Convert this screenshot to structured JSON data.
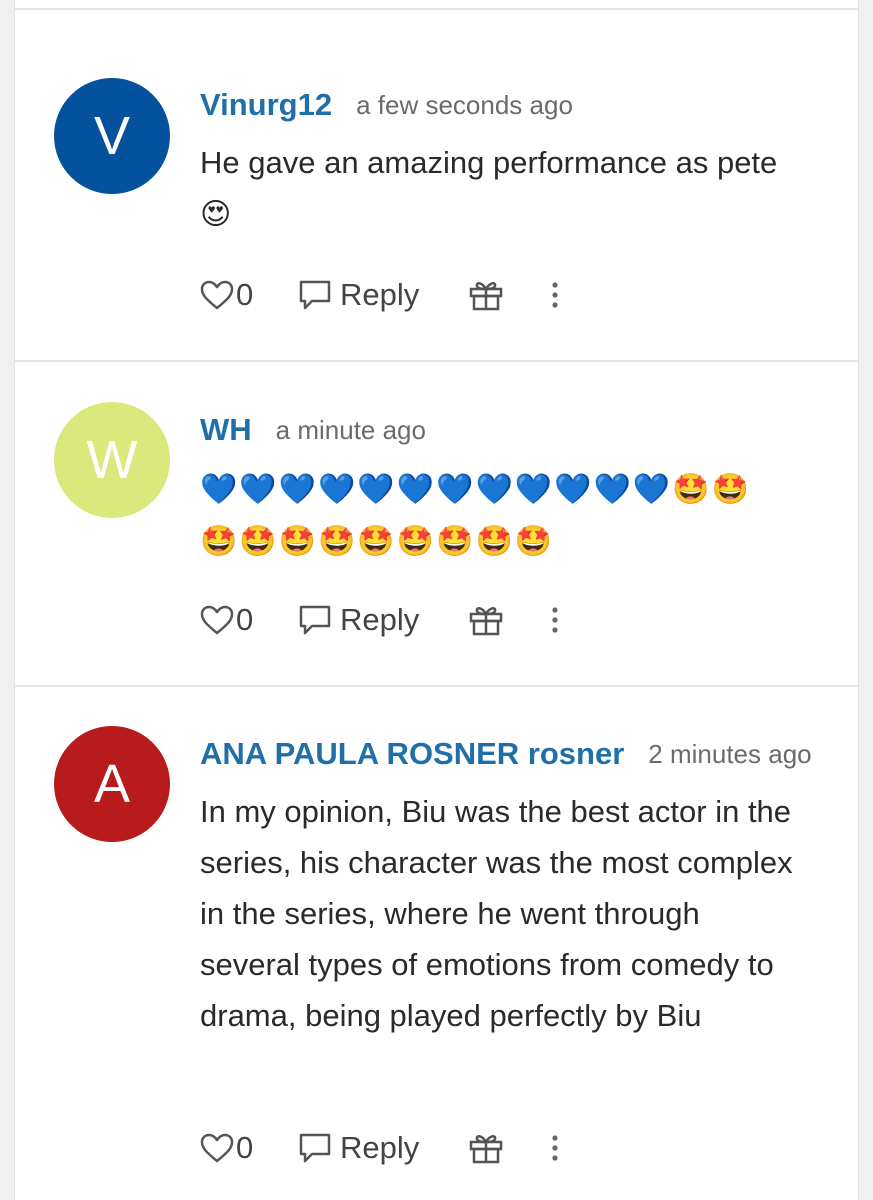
{
  "comments": [
    {
      "avatar_letter": "V",
      "avatar_color": "#04519e",
      "author": "Vinurg12",
      "time": "a few seconds ago",
      "text": "He gave an amazing performance as pete",
      "emoji": "😍",
      "likes": "0",
      "reply_label": "Reply"
    },
    {
      "avatar_letter": "W",
      "avatar_color": "#dbe87c",
      "author": "WH",
      "time": "a minute ago",
      "text": "",
      "emoji_line1": "💙💙💙💙💙💙💙💙💙💙💙💙🤩🤩",
      "emoji_line2": "🤩🤩🤩🤩🤩🤩🤩🤩🤩",
      "likes": "0",
      "reply_label": "Reply"
    },
    {
      "avatar_letter": "A",
      "avatar_color": "#b81b1b",
      "author": "ANA PAULA ROSNER rosner",
      "time": "2 minutes ago",
      "text": "In my opinion, Biu was the best actor in the series, his character was the most complex in the series, where he went through several types of emotions from comedy to drama, being played perfectly by Biu",
      "likes": "0",
      "reply_label": "Reply"
    }
  ],
  "icons": {
    "like": "heart-icon",
    "reply": "speech-bubble-icon",
    "gift": "gift-icon",
    "more": "more-vertical-icon"
  }
}
